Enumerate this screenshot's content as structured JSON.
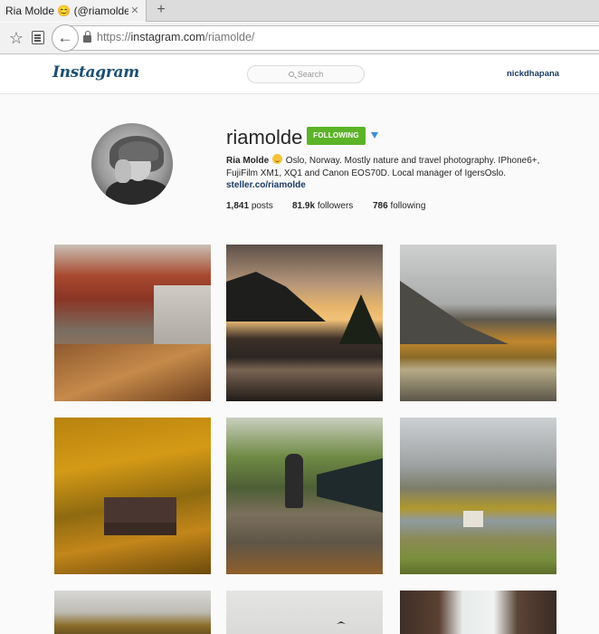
{
  "browser": {
    "tab_title": "Ria Molde 😊 (@riamolde...",
    "tab_close": "✕",
    "new_tab": "+",
    "url_prefix": "https://",
    "url_host": "instagram.com",
    "url_path": "/riamolde/"
  },
  "header": {
    "logo": "Instagram",
    "search_placeholder": "Search",
    "current_user": "nickdhapana"
  },
  "profile": {
    "username": "riamolde",
    "follow_label": "FOLLOWING",
    "bio_name": "Ria Molde",
    "bio_text": "Oslo, Norway. Mostly nature and travel photography. IPhone6+, FujiFilm XM1, XQ1 and Canon EOS70D. Local manager of IgersOslo.",
    "website": "steller.co/riamolde",
    "posts_count": "1,841",
    "posts_label": "posts",
    "followers_count": "81.9k",
    "followers_label": "followers",
    "following_count": "786",
    "following_label": "following"
  },
  "colors": {
    "follow_button": "#5bb327",
    "link": "#1a3b63",
    "logo": "#1d4f72"
  }
}
